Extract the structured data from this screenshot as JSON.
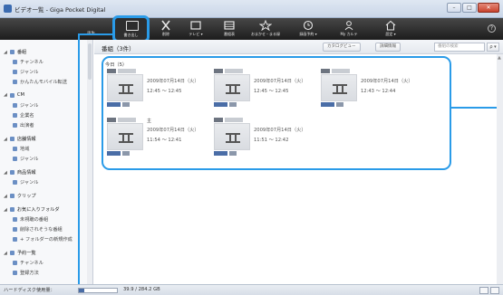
{
  "window": {
    "title": "ビデオ一覧 - Giga Pocket Digital",
    "controls": {
      "minimize": "–",
      "maximize": "□",
      "close": "✕"
    }
  },
  "toolbar": {
    "left_label": "再生",
    "highlighted": {
      "label": "書き出し",
      "icon": "export-icon"
    },
    "buttons": [
      {
        "label": "削除",
        "icon": "delete-x-icon"
      },
      {
        "label": "テレビ ▾",
        "icon": "tv-icon"
      },
      {
        "label": "番組表",
        "icon": "program-guide-icon"
      },
      {
        "label": "おまかせ・まる録",
        "icon": "auto-record-icon"
      },
      {
        "label": "録画予約 ▾",
        "icon": "clock-icon"
      },
      {
        "label": "My カルテ",
        "icon": "person-icon"
      },
      {
        "label": "設定 ▾",
        "icon": "settings-house-icon"
      }
    ],
    "help": "?"
  },
  "sidebar": {
    "items": [
      {
        "label": "番組",
        "level": 0,
        "head": true
      },
      {
        "label": "チャンネル",
        "level": 1
      },
      {
        "label": "ジャンル",
        "level": 1
      },
      {
        "label": "かんたんモバイル転送",
        "level": 1
      },
      {
        "label": "CM",
        "level": 0,
        "head": true
      },
      {
        "label": "ジャンル",
        "level": 1
      },
      {
        "label": "企業名",
        "level": 1
      },
      {
        "label": "出演者",
        "level": 1
      },
      {
        "label": "店舗情報",
        "level": 0,
        "head": true
      },
      {
        "label": "地域",
        "level": 1
      },
      {
        "label": "ジャンル",
        "level": 1
      },
      {
        "label": "商品情報",
        "level": 0,
        "head": true
      },
      {
        "label": "ジャンル",
        "level": 1
      },
      {
        "label": "クリップ",
        "level": 0,
        "head": true
      },
      {
        "label": "お気に入りフォルダ",
        "level": 0,
        "head": true
      },
      {
        "label": "未視聴の番組",
        "level": 1
      },
      {
        "label": "削除されそうな番組",
        "level": 1
      },
      {
        "label": "+ フォルダーの新規作成",
        "level": 1
      },
      {
        "label": "予約一覧",
        "level": 0,
        "head": true
      },
      {
        "label": "チャンネル",
        "level": 1
      },
      {
        "label": "登録方法",
        "level": 1
      }
    ]
  },
  "main": {
    "title": "番組（3件）",
    "view_button": "カタログビュー",
    "detail_button": "詳細情報",
    "search_placeholder": "番組の検索",
    "search_button": "ρ ▾",
    "group_label": "今日（5）",
    "mid_label": "主",
    "recordings": [
      {
        "date": "2009年07月14日（火）",
        "time": "12:45 ～ 12:45"
      },
      {
        "date": "2009年07月14日（火）",
        "time": "12:45 ～ 12:45"
      },
      {
        "date": "2009年07月14日（火）",
        "time": "12:43 ～ 12:44"
      },
      {
        "date": "2009年07月14日（火）",
        "time": "11:54 ～ 12:41"
      },
      {
        "date": "2009年07月14日（火）",
        "time": "11:51 ～ 12:42"
      }
    ]
  },
  "status": {
    "disk_label": "ハードディスク使用量：",
    "disk_value": "39.9 / 284.2 GB",
    "disk_fraction": 0.14
  },
  "colors": {
    "accent": "#2a9be8",
    "toolbar_bg": "#2a2a2a"
  }
}
